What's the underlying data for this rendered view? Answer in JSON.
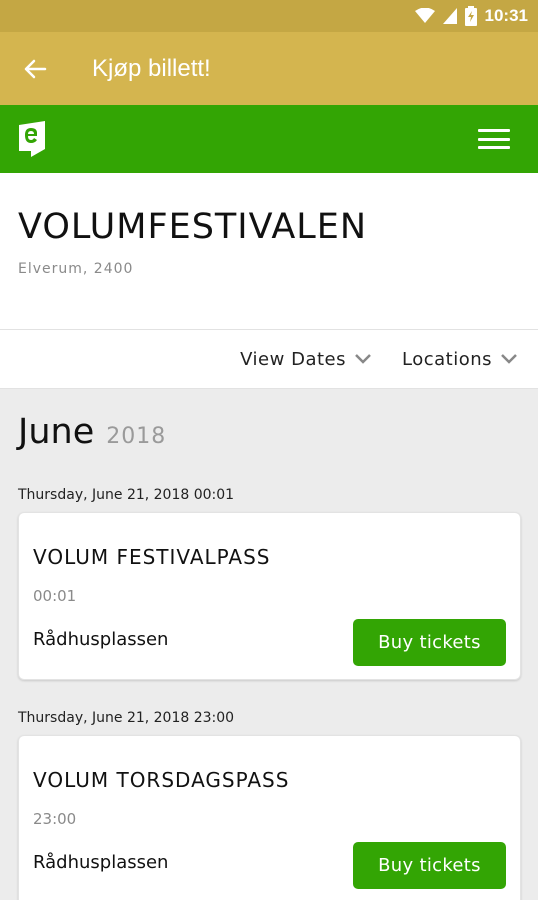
{
  "status_bar": {
    "time": "10:31"
  },
  "app_bar": {
    "title": "Kjøp billett!"
  },
  "colors": {
    "status_bar": "#c4a744",
    "app_bar": "#d4b54f",
    "brand_green": "#33a504"
  },
  "event": {
    "title": "VOLUMFESTIVALEN",
    "subtitle": "Elverum, 2400"
  },
  "filters": {
    "view_dates": "View Dates",
    "locations": "Locations"
  },
  "month": {
    "name": "June",
    "year": "2018"
  },
  "listings": [
    {
      "date": "Thursday, June 21, 2018 00:01",
      "name": "VOLUM FESTIVALPASS",
      "time": "00:01",
      "location": "Rådhusplassen",
      "button": "Buy tickets"
    },
    {
      "date": "Thursday, June 21, 2018 23:00",
      "name": "VOLUM TORSDAGSPASS",
      "time": "23:00",
      "location": "Rådhusplassen",
      "button": "Buy tickets"
    }
  ]
}
